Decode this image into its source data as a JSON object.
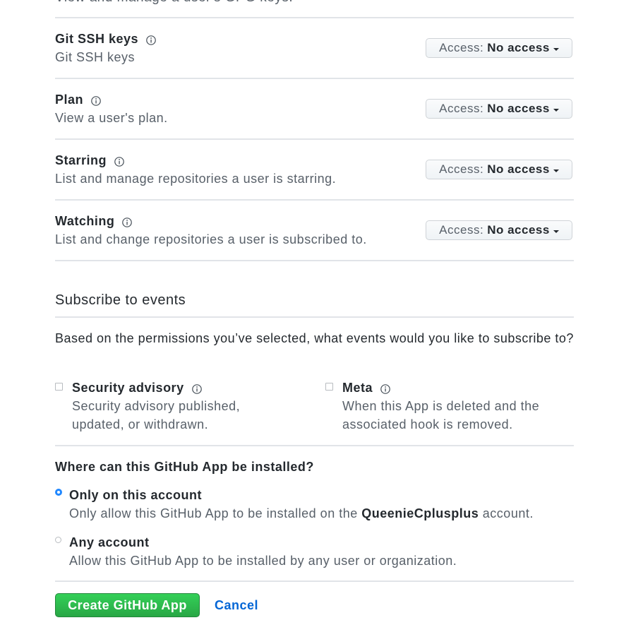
{
  "top_clipped_text": "View and manage a user's GPG keys.",
  "access_label": "Access:",
  "permissions": [
    {
      "title": "Git SSH keys",
      "desc": "Git SSH keys",
      "access": "No access"
    },
    {
      "title": "Plan",
      "desc": "View a user's plan.",
      "access": "No access"
    },
    {
      "title": "Starring",
      "desc": "List and manage repositories a user is starring.",
      "access": "No access"
    },
    {
      "title": "Watching",
      "desc": "List and change repositories a user is subscribed to.",
      "access": "No access"
    }
  ],
  "events": {
    "heading": "Subscribe to events",
    "prose": "Based on the permissions you’ve selected, what events would you like to subscribe to?",
    "items": [
      {
        "title": "Security advisory",
        "desc_line1": "Security advisory published,",
        "desc_line2": "updated, or withdrawn.",
        "checked": false
      },
      {
        "title": "Meta",
        "desc_line1": "When this App is deleted and the",
        "desc_line2": "associated hook is removed.",
        "checked": false
      }
    ]
  },
  "install": {
    "question": "Where can this GitHub App be installed?",
    "options": [
      {
        "title": "Only on this account",
        "desc_prefix": "Only allow this GitHub App to be installed on the",
        "account": "QueenieCplusplus",
        "desc_suffix": "account.",
        "selected": true
      },
      {
        "title": "Any account",
        "desc": "Allow this GitHub App to be installed by any user or organization.",
        "selected": false
      }
    ]
  },
  "actions": {
    "create_label": "Create GitHub App",
    "cancel_label": "Cancel"
  },
  "colors": {
    "accent_blue": "#0366d6",
    "radio_blue": "#2188ff",
    "create_green": "#2ea44f",
    "text": "#24292e",
    "muted": "#586069",
    "border": "#e1e4e8"
  },
  "icons": {
    "info": "info-circle-icon",
    "caret": "caret-down-icon"
  }
}
